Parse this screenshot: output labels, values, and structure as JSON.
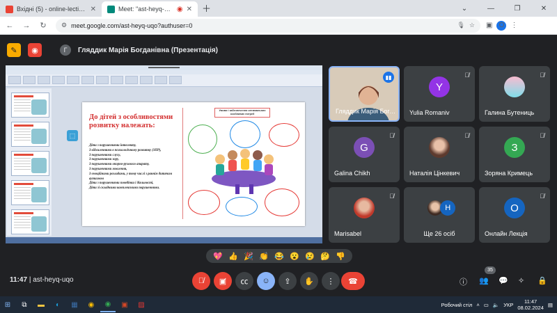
{
  "browser": {
    "tabs": [
      {
        "label": "Вхідні (5) - online-lection@ipp",
        "favicon_color": "#ea4335",
        "active": false
      },
      {
        "label": "Meet: \"ast-heyq-uqo\"",
        "favicon_color": "#00897b",
        "active": true
      }
    ],
    "new_tab_icon": "plus-icon",
    "url": "meet.google.com/ast-heyq-uqo?authuser=0",
    "profile_initial": "O"
  },
  "meet": {
    "presenter_initial": "Г",
    "presenter_label": "Гляддик Марія Богданівна (Презентація)",
    "meeting_code": "ast-heyq-uqo",
    "time": "11:47",
    "participants_count": "35",
    "participants": [
      {
        "name": "Гляддик Марія Богд...",
        "initial": "",
        "color": "",
        "speaking": true
      },
      {
        "name": "Yulia Romaniv",
        "initial": "Y",
        "color": "#9334e6",
        "muted": true
      },
      {
        "name": "Галина Бутениць",
        "initial": "",
        "color": "#f48fb1",
        "muted": true
      },
      {
        "name": "Galina Chikh",
        "initial": "G",
        "color": "#7b4fb5",
        "muted": true
      },
      {
        "name": "Наталія Цінкевич",
        "initial": "",
        "color": "#8d5b4c",
        "muted": true
      },
      {
        "name": "Зоряна Кримець",
        "initial": "З",
        "color": "#34a853",
        "muted": true
      },
      {
        "name": "Marisabel",
        "initial": "",
        "color": "#d95f4a",
        "muted": true
      },
      {
        "name": "Ще 26 осіб",
        "initial": "Н",
        "color": "#1565c0",
        "muted": false
      },
      {
        "name": "Онлайн Лекція",
        "initial": "O",
        "color": "#1565c0",
        "muted": true
      }
    ],
    "reactions": [
      "💖",
      "👍",
      "🎉",
      "👏",
      "😂",
      "😮",
      "😢",
      "🤔",
      "👎"
    ]
  },
  "slide": {
    "heading": "До дітей з особливостями розвитку належать:",
    "list": [
      "Діти з порушеннями інтелекту,",
      "З відхиленнями в психологічному розвитку (ЗПР),",
      "З порушеннями слуху,",
      "З порушеннями зору,",
      "З порушеннями опорно-рухового апарату,",
      "З порушеннями мовлення,",
      "З емоційними розладами, у тому числі з раннім дитячим аутизмом",
      "Діти з порушеннями поведінки і діяльності,",
      "Діти зі складними комплексними порушеннями."
    ],
    "art_title": "Умови і забезпечення оптимальних особливих потреб"
  },
  "taskbar": {
    "desktop_label": "Робочий стіл",
    "lang": "УКР",
    "clock_time": "11:47",
    "clock_date": "08.02.2024"
  }
}
